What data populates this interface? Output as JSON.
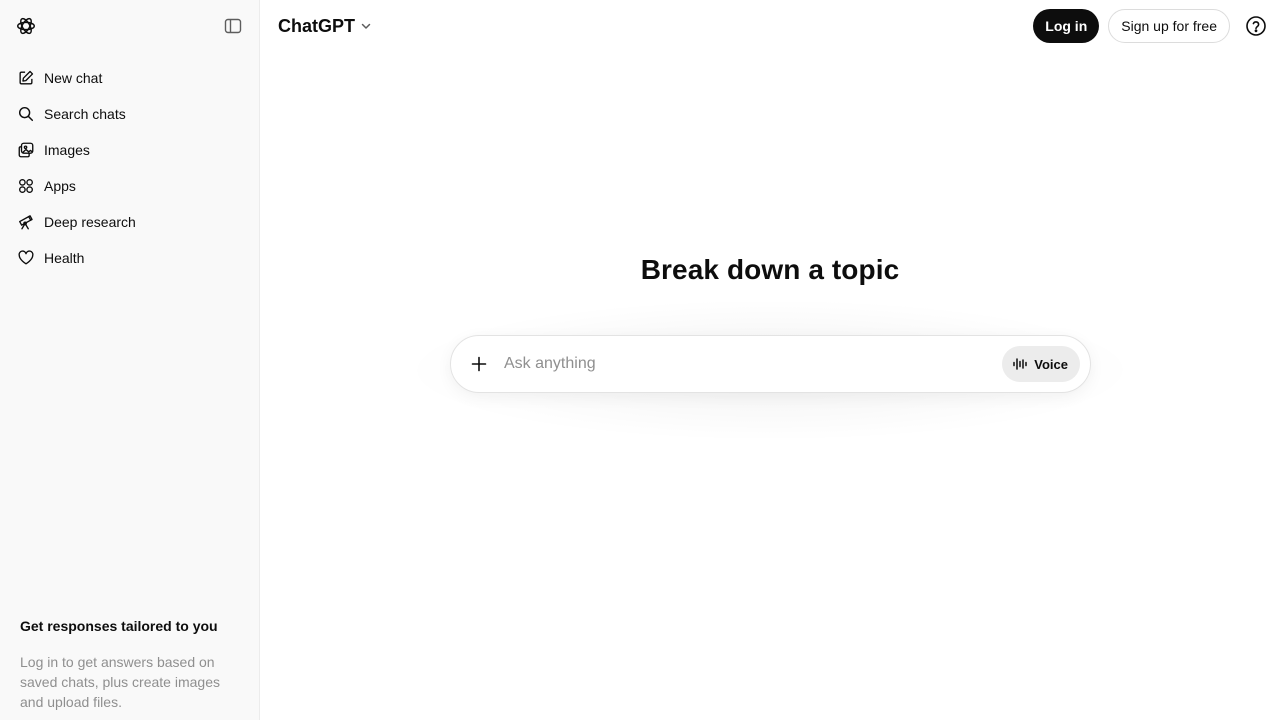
{
  "sidebar": {
    "items": [
      {
        "label": "New chat",
        "icon": "new-chat-icon"
      },
      {
        "label": "Search chats",
        "icon": "search-icon"
      },
      {
        "label": "Images",
        "icon": "images-icon"
      },
      {
        "label": "Apps",
        "icon": "apps-icon"
      },
      {
        "label": "Deep research",
        "icon": "telescope-icon"
      },
      {
        "label": "Health",
        "icon": "heart-icon"
      }
    ],
    "promo": {
      "title": "Get responses tailored to you",
      "text": "Log in to get answers based on saved chats, plus create images and upload files."
    }
  },
  "header": {
    "model_label": "ChatGPT",
    "login_label": "Log in",
    "signup_label": "Sign up for free"
  },
  "main": {
    "headline": "Break down a topic",
    "composer": {
      "placeholder": "Ask anything",
      "voice_label": "Voice"
    }
  },
  "colors": {
    "sidebar_bg": "#f9f9f9",
    "primary_button": "#0d0d0d",
    "placeholder": "#8f8f8f"
  }
}
